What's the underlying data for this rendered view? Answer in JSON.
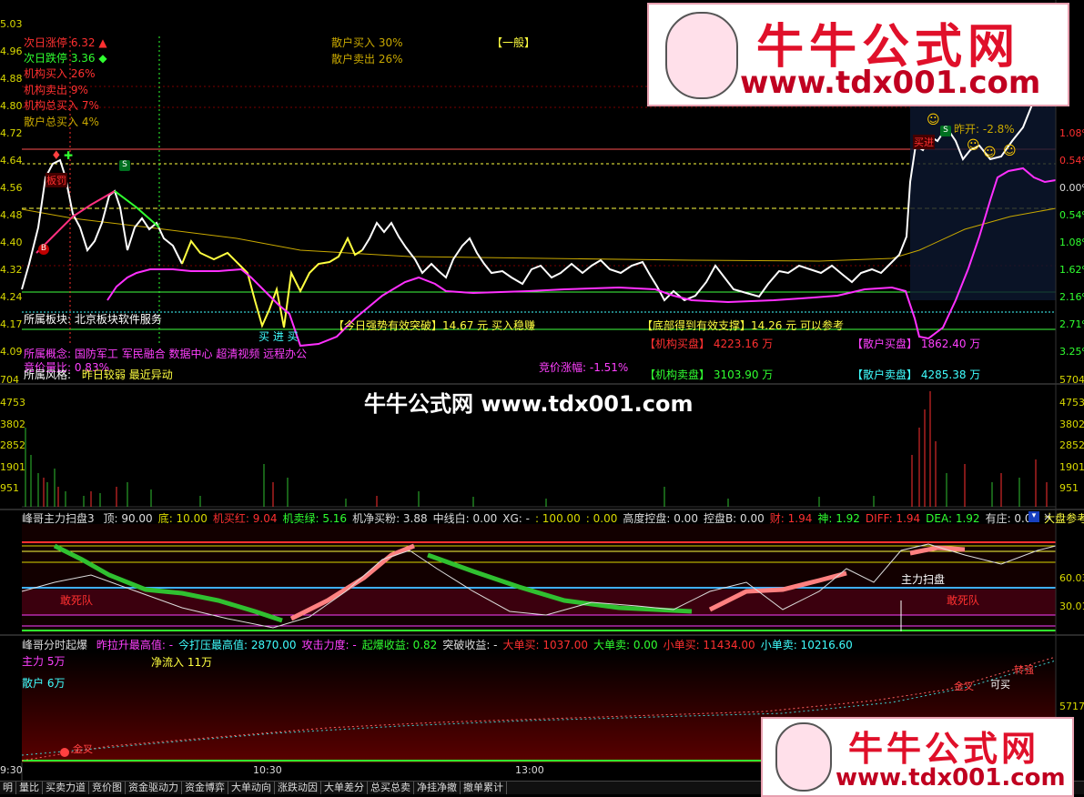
{
  "price_axis_left": [
    "5.03",
    "4.96",
    "4.88",
    "4.80",
    "4.72",
    "4.64",
    "4.56",
    "4.48",
    "4.40",
    "4.32",
    "4.24",
    "4.17",
    "4.09"
  ],
  "vol_axis_left": [
    "704",
    "4753",
    "3802",
    "2852",
    "1901",
    "951"
  ],
  "pct_axis_right": [
    "1.08%",
    "0.54%",
    "0.00%",
    "0.54%",
    "1.08%",
    "1.62%",
    "2.16%",
    "2.71%",
    "3.25%"
  ],
  "vol_axis_right": [
    "5704",
    "4753",
    "3802",
    "2852",
    "1901",
    "951"
  ],
  "osc_axis_right": [
    "60.03",
    "30.01"
  ],
  "flow_axis_right": "5717",
  "info_left": [
    {
      "label": "次日涨停",
      "value": "6.32",
      "mark": "▲",
      "color": "#ff3030"
    },
    {
      "label": "次日跌停",
      "value": "3.36",
      "mark": "◆",
      "color": "#30ff30"
    },
    {
      "label": "机构买入",
      "value": "26%",
      "mark": "",
      "color": "#ff3030"
    },
    {
      "label": "机构卖出",
      "value": "9%",
      "mark": "",
      "color": "#ff3030"
    },
    {
      "label": "机构总买入",
      "value": "7%",
      "mark": "",
      "color": "#ff3030"
    },
    {
      "label": "散户总买入",
      "value": "4%",
      "mark": "",
      "color": "#c8a800"
    }
  ],
  "info_mid": [
    "散户买入 30%",
    "散户卖出 26%"
  ],
  "tag_general": "【一般】",
  "sector": {
    "label": "所属板块:",
    "value": "北京板块软件服务"
  },
  "concept": {
    "label": "所属概念:",
    "value": "国防军工 军民融合 数据中心 超清视频 远程办公"
  },
  "auction_ratio": "竞价量比: 0.83%",
  "style": {
    "label": "所属风格:",
    "value": "昨日较弱 最近异动"
  },
  "buy_tip": "买 进 买",
  "strong_break": "【今日强势有效突破】14.67 元 买入稳赚",
  "bottom_support": "【底部得到有效支撑】14.26 元 可以参考",
  "inst_buy": {
    "label": "【机构买盘】",
    "value": "4223.16 万"
  },
  "inst_sell": {
    "label": "【机构卖盘】",
    "value": "3103.90 万"
  },
  "retail_buy": {
    "label": "【散户买盘】",
    "value": "1862.40 万"
  },
  "retail_sell": {
    "label": "【散户卖盘】",
    "value": "4285.38 万"
  },
  "auction_amp": "竞价涨幅: -1.51%",
  "yesterday_open": "昨开: -2.8%",
  "signal_sell": "S",
  "signal_buy": "B",
  "label_bankao": "板罚",
  "label_buyer": "买进",
  "watermark": "牛牛公式网 www.tdx001.com",
  "logo_top": {
    "title": "牛牛公式网",
    "url": "www.tdx001.com"
  },
  "logo_bottom": {
    "title": "牛牛公式网",
    "url": "www.tdx001.com"
  },
  "ind1": {
    "name": "峰哥主力扫盘3",
    "items": [
      {
        "t": "顶: 90.00",
        "c": "#dddddd"
      },
      {
        "t": "底: 10.00",
        "c": "#d9d900"
      },
      {
        "t": "机买红: 9.04",
        "c": "#ff3030"
      },
      {
        "t": "机卖绿: 5.16",
        "c": "#30ff30"
      },
      {
        "t": "机净买粉: 3.88",
        "c": "#dddddd"
      },
      {
        "t": "中线白: 0.00",
        "c": "#dddddd"
      },
      {
        "t": "XG: -",
        "c": "#dddddd"
      },
      {
        "t": ": 100.00",
        "c": "#d9d900"
      },
      {
        "t": ": 0.00",
        "c": "#d9d900"
      },
      {
        "t": "高度控盘: 0.00",
        "c": "#dddddd"
      },
      {
        "t": "控盘B: 0.00",
        "c": "#dddddd"
      },
      {
        "t": "财: 1.94",
        "c": "#ff3030"
      },
      {
        "t": "神: 1.92",
        "c": "#30ff30"
      },
      {
        "t": "DIFF: 1.94",
        "c": "#ff3030"
      },
      {
        "t": "DEA: 1.92",
        "c": "#30ff30"
      },
      {
        "t": "有庄: 0.00",
        "c": "#dddddd"
      },
      {
        "t": "大盘参考线: -",
        "c": "#ffff40"
      }
    ],
    "sweep": "主力扫盘",
    "dead1": "敢死队",
    "dead2": "敢死队"
  },
  "ind2": {
    "name": "峰哥分时起爆",
    "items": [
      {
        "t": "昨拉升最高值: -",
        "c": "#ff40ff"
      },
      {
        "t": "今打压最高值: 2870.00",
        "c": "#40ffff"
      },
      {
        "t": "攻击力度: -",
        "c": "#ff40ff"
      },
      {
        "t": "起爆收益: 0.82",
        "c": "#30ff30"
      },
      {
        "t": "突破收益: -",
        "c": "#dddddd"
      },
      {
        "t": "大单买: 1037.00",
        "c": "#ff3030"
      },
      {
        "t": "大单卖: 0.00",
        "c": "#30ff30"
      },
      {
        "t": "小单买: 11434.00",
        "c": "#ff3030"
      },
      {
        "t": "小单卖: 10216.60",
        "c": "#40ffff"
      }
    ],
    "main_force": "主力 5万",
    "retail": "散户 6万",
    "net_inflow": "净流入 11万",
    "gold": "金叉",
    "can_buy": "可买",
    "turn_strong": "转强"
  },
  "time_axis": [
    "9:30",
    "10:30",
    "13:00"
  ],
  "tabs": [
    "明",
    "量比",
    "买卖力道",
    "竞价图",
    "资金驱动力",
    "资金博弈",
    "大单动向",
    "涨跌动因",
    "大单差分",
    "总买总卖",
    "净挂净撤",
    "撤单累计"
  ]
}
